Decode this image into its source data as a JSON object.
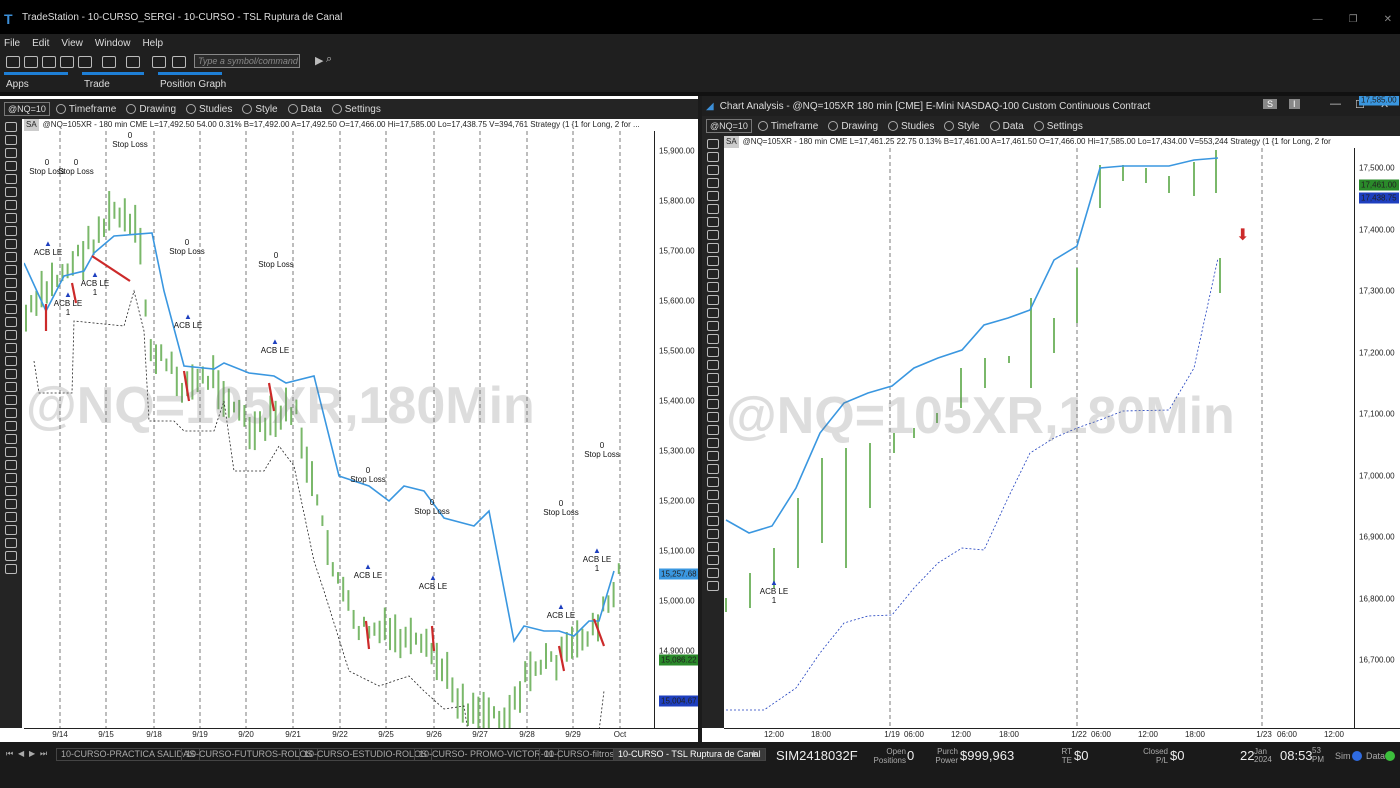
{
  "window": {
    "title": "TradeStation - 10-CURSO_SERGI - 10-CURSO - TSL Ruptura de Canal"
  },
  "menu": [
    "File",
    "Edit",
    "View",
    "Window",
    "Help"
  ],
  "toolbar": {
    "symbol_placeholder": "Type a symbol/command"
  },
  "workspace_tabs": [
    "Apps",
    "Trade",
    "Position Graph"
  ],
  "left_chart": {
    "symbol_select": "@NQ=10",
    "toolbar_items": [
      "Timeframe",
      "Drawing",
      "Studies",
      "Style",
      "Data",
      "Settings"
    ],
    "info_line": "@NQ=105XR - 180 min  CME  L=17,492.50  54.00  0.31%  B=17,492.00  A=17,492.50  O=17,466.00  Hi=17,585.00  Lo=17,438.75  V=394,761  Strategy (1 {1 for Long, 2 for ...",
    "sa_label": "SA",
    "watermark": "@NQ=105XR,180Min",
    "x_labels": [
      "9/14",
      "9/15",
      "9/18",
      "9/19",
      "9/20",
      "9/21",
      "9/22",
      "9/25",
      "9/26",
      "9/27",
      "9/28",
      "9/29",
      "Oct"
    ],
    "y_labels": [
      "15,900.00",
      "15,800.00",
      "15,700.00",
      "15,600.00",
      "15,500.00",
      "15,400.00",
      "15,300.00",
      "15,200.00",
      "15,100.00",
      "15,000.00",
      "14,900.00",
      "14,800.00"
    ],
    "badges": [
      {
        "text": "15,257.68",
        "color": "#3a97e0"
      },
      {
        "text": "15,086.22",
        "color": "#2a8a2a"
      },
      {
        "text": "15,004.67",
        "color": "#1e3fbf"
      }
    ],
    "annotations": {
      "stop_count": "0",
      "stop": "Stop Loss",
      "entry": "ACB LE",
      "entry_qty": "1"
    }
  },
  "right_chart": {
    "title": "Chart Analysis - @NQ=105XR 180 min [CME] E-Mini NASDAQ-100 Custom Continuous Contract",
    "title_buttons": [
      "S",
      "I"
    ],
    "symbol_select": "@NQ=10",
    "toolbar_items": [
      "Timeframe",
      "Drawing",
      "Studies",
      "Style",
      "Data",
      "Settings"
    ],
    "info_line": "@NQ=105XR - 180 min  CME  L=17,461.25  22.75  0.13%  B=17,461.00  A=17,461.50  O=17,466.00  Hi=17,585.00  Lo=17,434.00  V=553,244  Strategy (1 {1 for Long, 2 for",
    "sa_label": "SA",
    "watermark": "@NQ=105XR,180Min",
    "x_labels": [
      "12:00",
      "18:00",
      "1/19",
      "06:00",
      "12:00",
      "18:00",
      "1/22",
      "06:00",
      "12:00",
      "18:00",
      "1/23",
      "06:00",
      "12:00"
    ],
    "y_labels": [
      "17,500.00",
      "17,400.00",
      "17,300.00",
      "17,200.00",
      "17,100.00",
      "17,000.00",
      "16,900.00",
      "16,800.00",
      "16,700.00"
    ],
    "badges": [
      {
        "text": "17,585.00",
        "color": "#3a97e0"
      },
      {
        "text": "17,461.00",
        "color": "#2a8a2a"
      },
      {
        "text": "17,438.75",
        "color": "#1e3fbf"
      }
    ],
    "annotations": {
      "entry": "ACB LE",
      "entry_qty": "1"
    }
  },
  "sheet_tabs": [
    "10-CURSO-PRACTICA SALIDAS",
    "10-CURSO-FUTUROS-ROLOS",
    "10-CURSO-ESTUDIO-ROLOS",
    "10-CURSO- PROMO-VICTOR-01",
    "10-CURSO-filtros",
    "10-CURSO - TSL Ruptura de Canal"
  ],
  "status": {
    "account": "SIM2418032F",
    "open_positions_label": "Open Positions",
    "open_positions": "0",
    "purch_power_label": "Purch Power",
    "purch_power": "$999,963",
    "rt_te_label": "RT TE",
    "rt_te": "$0",
    "closed_pl_label": "Closed P/L",
    "closed_pl": "$0",
    "day": "22",
    "month": "Jan",
    "year": "2024",
    "time": "08:53",
    "seconds": "53",
    "ampm": "PM",
    "sim": "Sim",
    "data": "Data"
  }
}
